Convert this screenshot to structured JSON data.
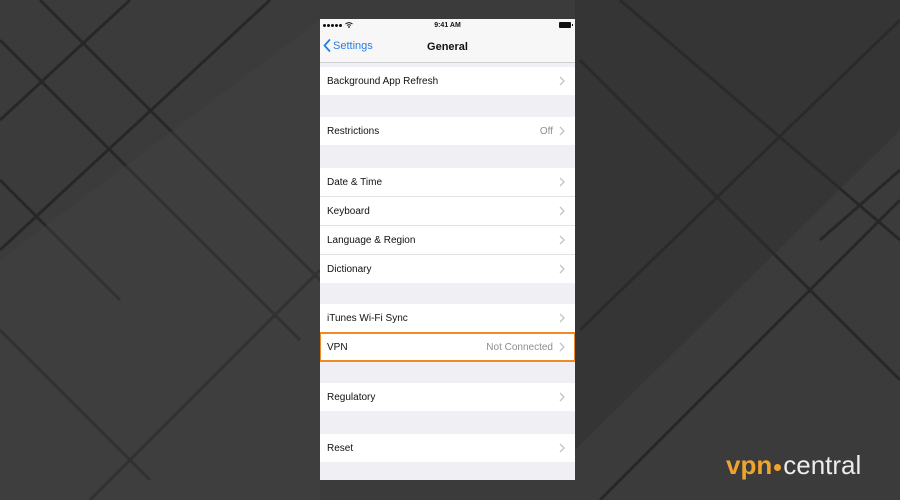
{
  "status_bar": {
    "time": "9:41 AM"
  },
  "nav": {
    "back_label": "Settings",
    "title": "General"
  },
  "groups": [
    {
      "rows": [
        {
          "label": "Background App Refresh",
          "value": ""
        }
      ]
    },
    {
      "rows": [
        {
          "label": "Restrictions",
          "value": "Off"
        }
      ]
    },
    {
      "rows": [
        {
          "label": "Date & Time",
          "value": ""
        },
        {
          "label": "Keyboard",
          "value": ""
        },
        {
          "label": "Language & Region",
          "value": ""
        },
        {
          "label": "Dictionary",
          "value": ""
        }
      ]
    },
    {
      "rows": [
        {
          "label": "iTunes Wi-Fi Sync",
          "value": ""
        },
        {
          "label": "VPN",
          "value": "Not Connected"
        }
      ]
    },
    {
      "rows": [
        {
          "label": "Regulatory",
          "value": ""
        }
      ]
    },
    {
      "rows": [
        {
          "label": "Reset",
          "value": ""
        }
      ]
    }
  ],
  "watermark": {
    "part1": "vpn",
    "part2": "central"
  },
  "colors": {
    "accent": "#2a7de1",
    "highlight": "#f08a24",
    "logo_orange": "#f0a430"
  }
}
